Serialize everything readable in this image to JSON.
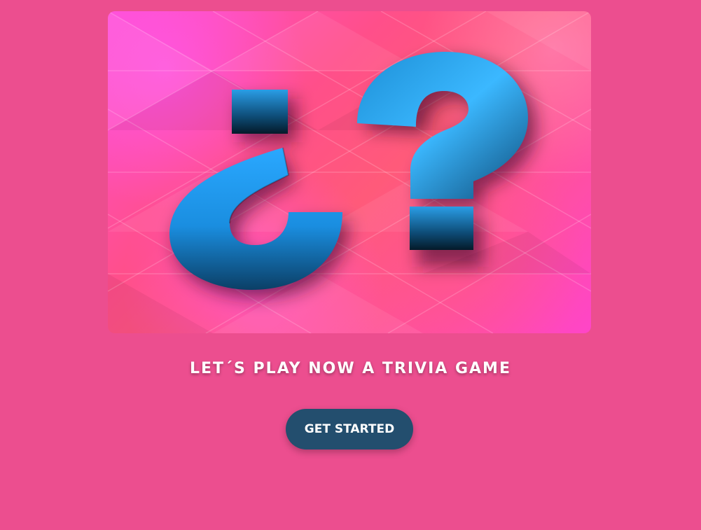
{
  "hero": {
    "image_alt": "Question marks",
    "icon": "question-marks-illustration",
    "colors": {
      "background": "#ec4e8f",
      "glyph": "#1f9cf0"
    }
  },
  "tagline": "LET´S PLAY NOW A TRIVIA GAME",
  "cta": {
    "label": "GET STARTED",
    "color": "#234e6e"
  }
}
